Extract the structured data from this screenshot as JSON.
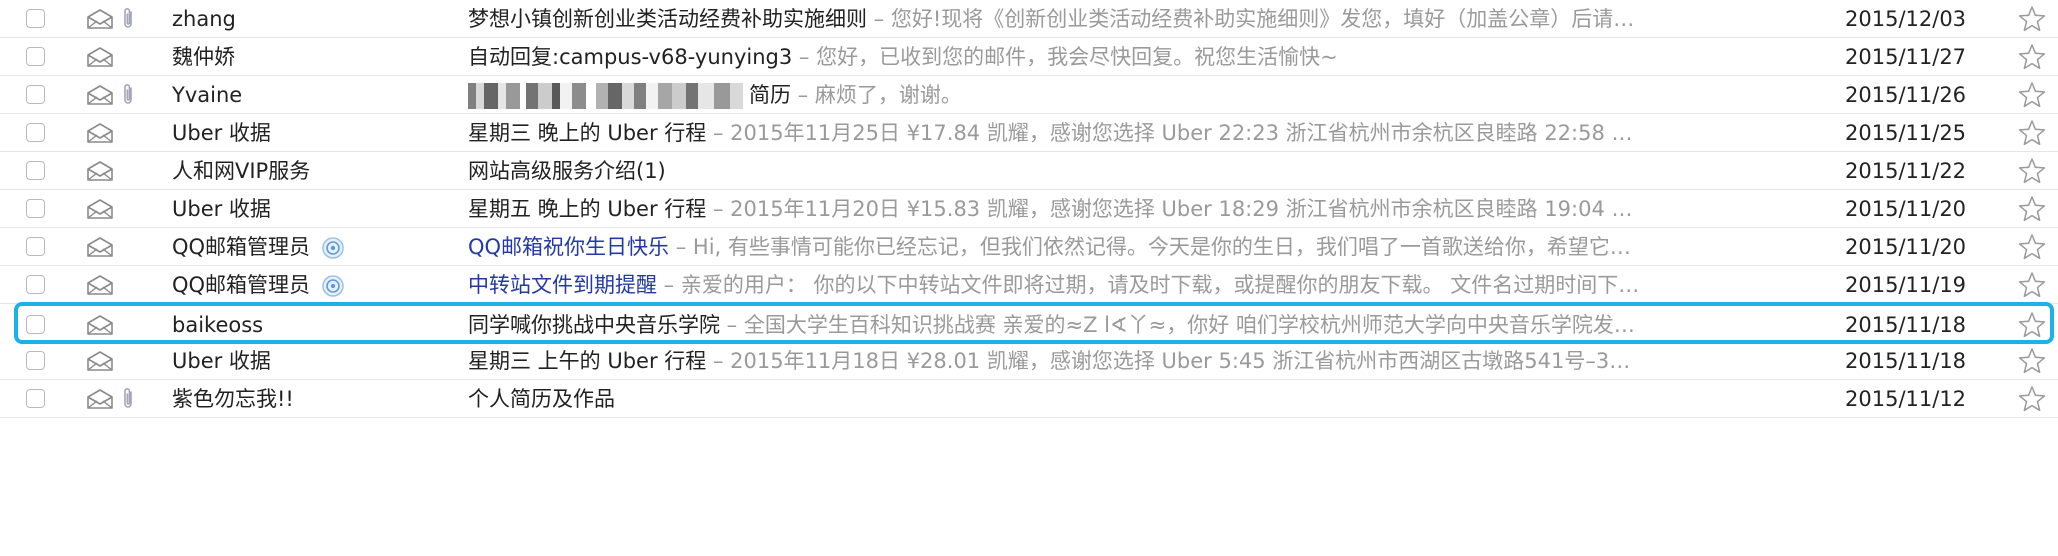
{
  "emails": [
    {
      "sender": "zhang",
      "sender_badge": false,
      "attachment": true,
      "subject": "梦想小镇创新创业类活动经费补助实施细则",
      "subject_blue": false,
      "subject_redacted": false,
      "preview": " – 您好!现将《创新创业类活动经费补助实施细则》发您，填好（加盖公章）后请…",
      "date": "2015/12/03",
      "highlighted": false
    },
    {
      "sender": "魏仲娇",
      "sender_badge": false,
      "attachment": false,
      "subject": "自动回复:campus-v68-yunying3",
      "subject_blue": false,
      "subject_redacted": false,
      "preview": " – 您好，已收到您的邮件，我会尽快回复。祝您生活愉快~",
      "date": "2015/11/27",
      "highlighted": false
    },
    {
      "sender": "Yvaine",
      "sender_badge": false,
      "attachment": true,
      "subject": "简历",
      "subject_blue": false,
      "subject_redacted": true,
      "preview": " – 麻烦了，谢谢。",
      "date": "2015/11/26",
      "highlighted": false
    },
    {
      "sender": "Uber 收据",
      "sender_badge": false,
      "attachment": false,
      "subject": "星期三 晚上的 Uber 行程",
      "subject_blue": false,
      "subject_redacted": false,
      "preview": " –  2015年11月25日 ¥17.84 凯耀，感谢您选择 Uber 22:23 浙江省杭州市余杭区良睦路 22:58 …",
      "date": "2015/11/25",
      "highlighted": false
    },
    {
      "sender": "人和网VIP服务",
      "sender_badge": false,
      "attachment": false,
      "subject": "网站高级服务介绍(1)",
      "subject_blue": false,
      "subject_redacted": false,
      "preview": "",
      "date": "2015/11/22",
      "highlighted": false
    },
    {
      "sender": "Uber 收据",
      "sender_badge": false,
      "attachment": false,
      "subject": "星期五 晚上的 Uber 行程",
      "subject_blue": false,
      "subject_redacted": false,
      "preview": " –  2015年11月20日 ¥15.83 凯耀，感谢您选择 Uber 18:29 浙江省杭州市余杭区良睦路 19:04 …",
      "date": "2015/11/20",
      "highlighted": false
    },
    {
      "sender": "QQ邮箱管理员",
      "sender_badge": true,
      "attachment": false,
      "subject": "QQ邮箱祝你生日快乐",
      "subject_blue": true,
      "subject_redacted": false,
      "preview": " – Hi, 有些事情可能你已经忘记，但我们依然记得。今天是你的生日，我们唱了一首歌送给你，希望它…",
      "date": "2015/11/20",
      "highlighted": false
    },
    {
      "sender": "QQ邮箱管理员",
      "sender_badge": true,
      "attachment": false,
      "subject": "中转站文件到期提醒",
      "subject_blue": true,
      "subject_redacted": false,
      "preview": " – 亲爱的用户： 你的以下中转站文件即将过期，请及时下载，或提醒你的朋友下载。 文件名过期时间下…",
      "date": "2015/11/19",
      "highlighted": false
    },
    {
      "sender": "baikeoss",
      "sender_badge": false,
      "attachment": false,
      "subject": "同学喊你挑战中央音乐学院",
      "subject_blue": false,
      "subject_redacted": false,
      "preview": " –  全国大学生百科知识挑战赛 亲爱的≈Z l∢丫≈，你好 咱们学校杭州师范大学向中央音乐学院发…",
      "date": "2015/11/18",
      "highlighted": true
    },
    {
      "sender": "Uber 收据",
      "sender_badge": false,
      "attachment": false,
      "subject": "星期三 上午的 Uber 行程",
      "subject_blue": false,
      "subject_redacted": false,
      "preview": " –  2015年11月18日 ¥28.01 凯耀，感谢您选择 Uber 5:45 浙江省杭州市西湖区古墩路541号–3…",
      "date": "2015/11/18",
      "highlighted": false
    },
    {
      "sender": "紫色勿忘我!!",
      "sender_badge": false,
      "attachment": true,
      "subject": "个人简历及作品",
      "subject_blue": false,
      "subject_redacted": false,
      "preview": "",
      "date": "2015/11/12",
      "highlighted": false
    }
  ],
  "icons": {
    "checkbox": "checkbox-icon",
    "envelope": "envelope-open-icon",
    "attachment": "paperclip-icon",
    "badge": "qq-admin-badge-icon",
    "star": "star-icon"
  },
  "colors": {
    "highlight_border": "#1bb2e8",
    "blue_subject": "#233aa6",
    "preview_text": "#9a9a9a",
    "row_divider": "#e6e6e6"
  }
}
